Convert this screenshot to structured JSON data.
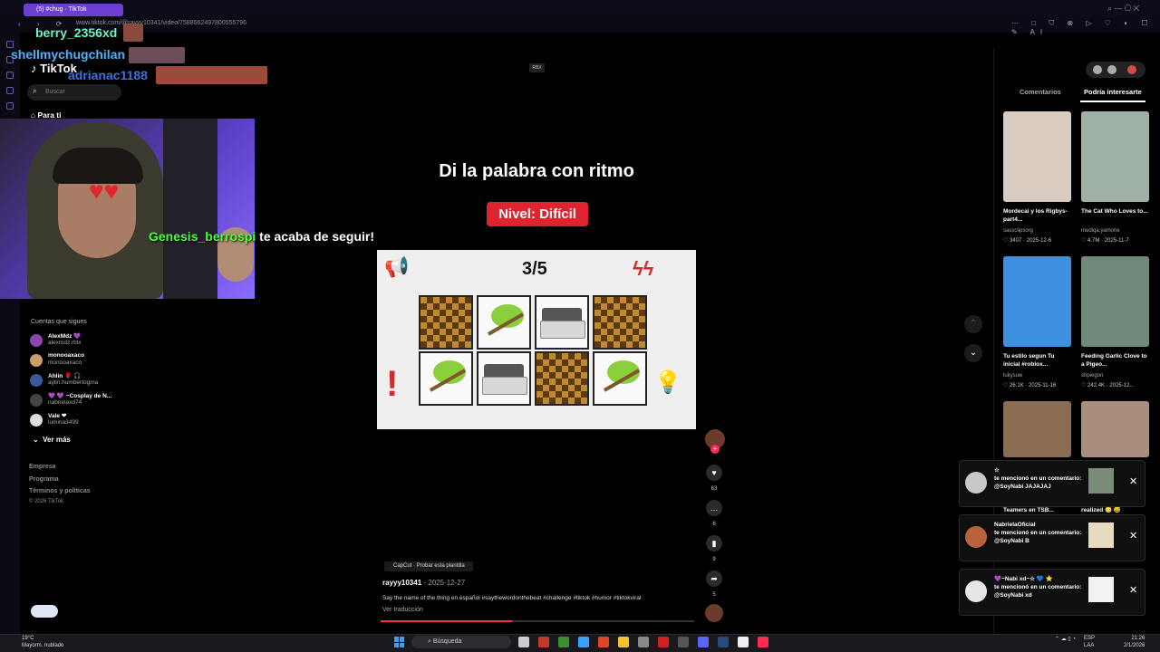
{
  "browser": {
    "tab_label": "(5) #chug · TikTok",
    "url": "www.tiktok.com/@rayyy10341/video/7588562497800555796",
    "nav_icons": "‹ › ⟳",
    "ext_icons": "⋯ □ ⛉ ⊗ ▷ ♡ ◐ ☐ ✎ AI",
    "window_controls": "⌕ — ▢ ✕"
  },
  "stream_overlay": {
    "chat": [
      {
        "name": "berry_2356xd",
        "color": "#6ef2c6"
      },
      {
        "name": "shellmychugchilan",
        "color": "#4db2ff"
      },
      {
        "name": "adrianac1188",
        "color": "#3f6fe0"
      }
    ],
    "follow_user": "Genesis_berrospi",
    "follow_text": " te acaba de seguir!"
  },
  "sidebar": {
    "logo": "TikTok",
    "search_placeholder": "Buscar",
    "for_you": "Para ti",
    "following_title": "Cuentas que sigues",
    "accounts": [
      {
        "name": "AlexMdz 💜",
        "handle": "alexmdz.rblx"
      },
      {
        "name": "monooaxaco",
        "handle": "monooaxaco"
      },
      {
        "name": "Ahlin 🌹 🎧",
        "handle": "aylin.humbertogma"
      },
      {
        "name": "💜 💜 ~Cosplay de N...",
        "handle": "nabrielaxd74"
      },
      {
        "name": "Vale ❤",
        "handle": "lumina3499"
      }
    ],
    "see_more": "Ver más",
    "footer": [
      "Empresa",
      "Programa",
      "Términos y políticas",
      "© 2026 TikTok"
    ]
  },
  "video": {
    "badge": "RBX",
    "title": "Di la palabra con ritmo",
    "level": "Nivel: Difícil",
    "counter": "3/5",
    "grid": [
      "chess",
      "tree",
      "bed",
      "chess",
      "tree",
      "bed",
      "chess",
      "tree"
    ],
    "capcut": "CapCut · Probar esta plantilla",
    "author": "rayyy10341",
    "date": " · 2025-12-27",
    "description": "Say the name of the thing en español #saythewordonthebeat #challenge #tiktok #humor #tiktokviral",
    "translate": "Ver traducción",
    "progress": 0.42
  },
  "actions": {
    "likes": "63",
    "comments": "6",
    "saves": "9",
    "shares": "5"
  },
  "right_panel": {
    "tab_comments": "Comentarios",
    "tab_interesting": "Podría interesarte",
    "items": [
      {
        "caption": "Mordecai y los Rigbys- part4...",
        "user": "sassclipsorg",
        "stats": "♡ 3407 · 2025-12-6",
        "color": "#d9cbbf"
      },
      {
        "caption": "The Cat Who Loves to...",
        "user": "modiqa.yamone",
        "stats": "♡ 4.7M · 2025-11-7",
        "color": "#9fb0a6"
      },
      {
        "caption": "Tu estilo segun Tu inicial #roblox...",
        "user": "lukysuw",
        "stats": "♡ 26.1K · 2025-11-16",
        "color": "#3d8fe0"
      },
      {
        "caption": "Feeding Garlic Clove to a Pigeo...",
        "user": "shpiegon",
        "stats": "♡ 242.4K · 2025-12...",
        "color": "#6f8a7a"
      },
      {
        "caption": "Teamers en TSB...",
        "user": "",
        "stats": "",
        "color": "#8a6c52"
      },
      {
        "caption": "realized 😳 😅",
        "user": "",
        "stats": "",
        "color": "#a98d7d"
      }
    ]
  },
  "notifications": [
    {
      "name": "☆",
      "text": "te mencionó en un comentario: @SoyNabi JAJAJAJ"
    },
    {
      "name": "NabrielaOficial",
      "text": "te mencionó en un comentario: @SoyNabi B"
    },
    {
      "name": "💜~Nabi xd~☆ 💙 ⭐",
      "text": "te mencionó en un comentario: @SoyNabi xd"
    }
  ],
  "taskbar": {
    "weather_temp": "19°C",
    "weather_desc": "Mayorm. nublado",
    "search": "Búsqueda",
    "lang": "ESP",
    "lang2": "LAA",
    "time": "21:26",
    "date": "2/1/2026",
    "tray": "⌃ ☁ ▯ ◔"
  }
}
